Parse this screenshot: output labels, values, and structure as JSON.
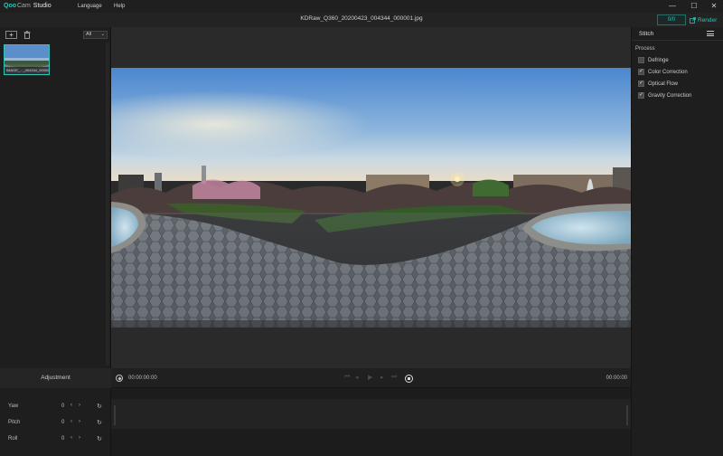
{
  "app": {
    "brand_prefix": "Qoo",
    "brand_cam": "Cam",
    "brand_name": "Studio",
    "menu": [
      "Language",
      "Help"
    ],
    "window_controls": [
      "minimize-icon",
      "maximize-icon",
      "close-icon"
    ]
  },
  "header": {
    "filename": "KDRaw_Q360_20200423_004344_000001.jpg",
    "counter": "0/0",
    "render_label": "Render"
  },
  "media_panel": {
    "filter_selected": "All",
    "thumbnail_caption": "IMAGE_..._004344_00000"
  },
  "stitch_panel": {
    "title": "Stitch",
    "process_title": "Process",
    "items": [
      {
        "label": "Defringe",
        "checked": false
      },
      {
        "label": "Color Correction",
        "checked": true
      },
      {
        "label": "Optical Flow",
        "checked": true
      },
      {
        "label": "Gravity Correction",
        "checked": true
      }
    ]
  },
  "adjustment": {
    "title": "Adjustment",
    "rows": [
      {
        "label": "Yaw",
        "value": "0"
      },
      {
        "label": "Pitch",
        "value": "0"
      },
      {
        "label": "Roll",
        "value": "0"
      }
    ]
  },
  "timeline": {
    "timecode_start": "00:00:00:00",
    "timecode_end": "00:00:00"
  },
  "colors": {
    "accent": "#2ec4b6",
    "background": "#1e1e1e"
  }
}
